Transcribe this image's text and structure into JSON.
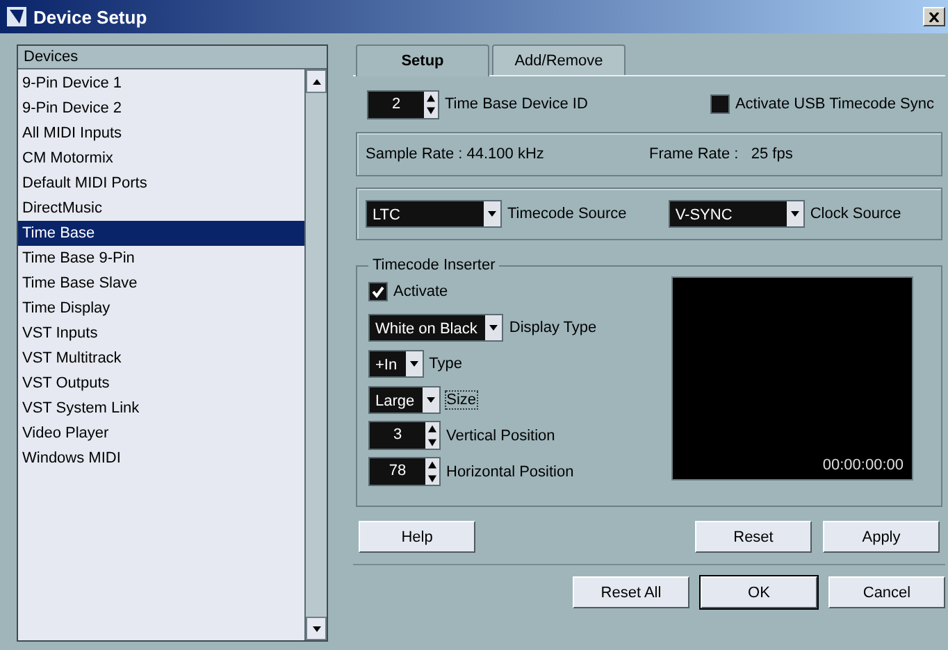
{
  "window": {
    "title": "Device Setup"
  },
  "devices": {
    "header": "Devices",
    "items": [
      {
        "label": "9-Pin Device 1",
        "selected": false
      },
      {
        "label": "9-Pin Device 2",
        "selected": false
      },
      {
        "label": "All MIDI Inputs",
        "selected": false
      },
      {
        "label": "CM Motormix",
        "selected": false
      },
      {
        "label": "Default MIDI Ports",
        "selected": false
      },
      {
        "label": "DirectMusic",
        "selected": false
      },
      {
        "label": "Time Base",
        "selected": true
      },
      {
        "label": "Time Base 9-Pin",
        "selected": false
      },
      {
        "label": "Time Base Slave",
        "selected": false
      },
      {
        "label": "Time Display",
        "selected": false
      },
      {
        "label": "VST Inputs",
        "selected": false
      },
      {
        "label": "VST Multitrack",
        "selected": false
      },
      {
        "label": "VST Outputs",
        "selected": false
      },
      {
        "label": "VST System Link",
        "selected": false
      },
      {
        "label": "Video Player",
        "selected": false
      },
      {
        "label": "Windows MIDI",
        "selected": false
      }
    ]
  },
  "tabs": [
    {
      "label": "Setup",
      "selected": true
    },
    {
      "label": "Add/Remove",
      "selected": false
    }
  ],
  "setup": {
    "device_id": {
      "value": "2",
      "label": "Time Base Device ID"
    },
    "usb_sync": {
      "label": "Activate USB Timecode Sync",
      "checked": false
    },
    "info": [
      "Sample Rate : 44.100 kHz",
      "Frame Rate :   25 fps"
    ],
    "timecode_source": {
      "value": "LTC",
      "label": "Timecode Source"
    },
    "clock_source": {
      "value": "V-SYNC",
      "label": "Clock Source"
    },
    "inserter": {
      "title": "Timecode Inserter",
      "activate": {
        "label": "Activate",
        "checked": true
      },
      "controls": [
        {
          "kind": "dropdown",
          "value": "White on Black",
          "label": "Display Type",
          "focused": false
        },
        {
          "kind": "dropdown",
          "value": "+In",
          "label": "Type",
          "focused": false
        },
        {
          "kind": "dropdown",
          "value": "Large",
          "label": "Size",
          "focused": true
        },
        {
          "kind": "spin",
          "value": "3",
          "label": "Vertical Position",
          "focused": false
        },
        {
          "kind": "spin",
          "value": "78",
          "label": "Horizontal Position",
          "focused": false
        }
      ],
      "preview_time": "00:00:00:00"
    }
  },
  "panel_buttons": [
    "Help",
    "Reset",
    "Apply"
  ],
  "dialog_buttons": [
    {
      "label": "Reset All",
      "default": false
    },
    {
      "label": "OK",
      "default": true
    },
    {
      "label": "Cancel",
      "default": false
    }
  ]
}
